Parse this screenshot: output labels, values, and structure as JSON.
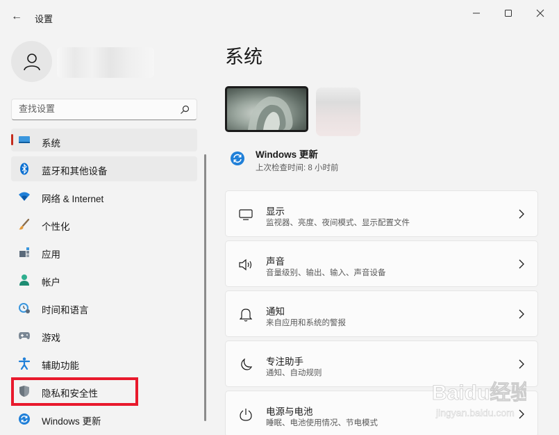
{
  "window": {
    "title": "设置",
    "back_glyph": "←",
    "min_glyph": "—",
    "max_glyph": "☐",
    "close_glyph": "✕"
  },
  "search": {
    "placeholder": "查找设置"
  },
  "sidebar": {
    "items": [
      {
        "label": "系统",
        "icon": "system-display-icon",
        "selected": true
      },
      {
        "label": "蓝牙和其他设备",
        "icon": "bluetooth-icon"
      },
      {
        "label": "网络 & Internet",
        "icon": "wifi-icon"
      },
      {
        "label": "个性化",
        "icon": "brush-icon"
      },
      {
        "label": "应用",
        "icon": "apps-icon"
      },
      {
        "label": "帐户",
        "icon": "account-icon"
      },
      {
        "label": "时间和语言",
        "icon": "clock-globe-icon"
      },
      {
        "label": "游戏",
        "icon": "gamepad-icon"
      },
      {
        "label": "辅助功能",
        "icon": "accessibility-icon"
      },
      {
        "label": "隐私和安全性",
        "icon": "shield-icon"
      },
      {
        "label": "Windows 更新",
        "icon": "update-icon"
      }
    ]
  },
  "main": {
    "title": "系统",
    "windows_update": {
      "title": "Windows 更新",
      "subtitle": "上次检查时间: 8 小时前"
    },
    "cards": [
      {
        "title": "显示",
        "subtitle": "监视器、亮度、夜间模式、显示配置文件",
        "icon": "monitor-icon"
      },
      {
        "title": "声音",
        "subtitle": "音量级别、输出、输入、声音设备",
        "icon": "speaker-icon"
      },
      {
        "title": "通知",
        "subtitle": "来自应用和系统的警报",
        "icon": "bell-icon"
      },
      {
        "title": "专注助手",
        "subtitle": "通知、自动规则",
        "icon": "moon-icon"
      },
      {
        "title": "电源与电池",
        "subtitle": "睡眠、电池使用情况、节电模式",
        "icon": "power-icon"
      }
    ]
  },
  "watermark": {
    "line1": "Baidu经验",
    "line2": "jingyan.baidu.com"
  },
  "colors": {
    "accent": "#0067c0",
    "selection_bar": "#c42b1c",
    "highlight_box": "#e8192c",
    "background": "#f3f3f3"
  }
}
